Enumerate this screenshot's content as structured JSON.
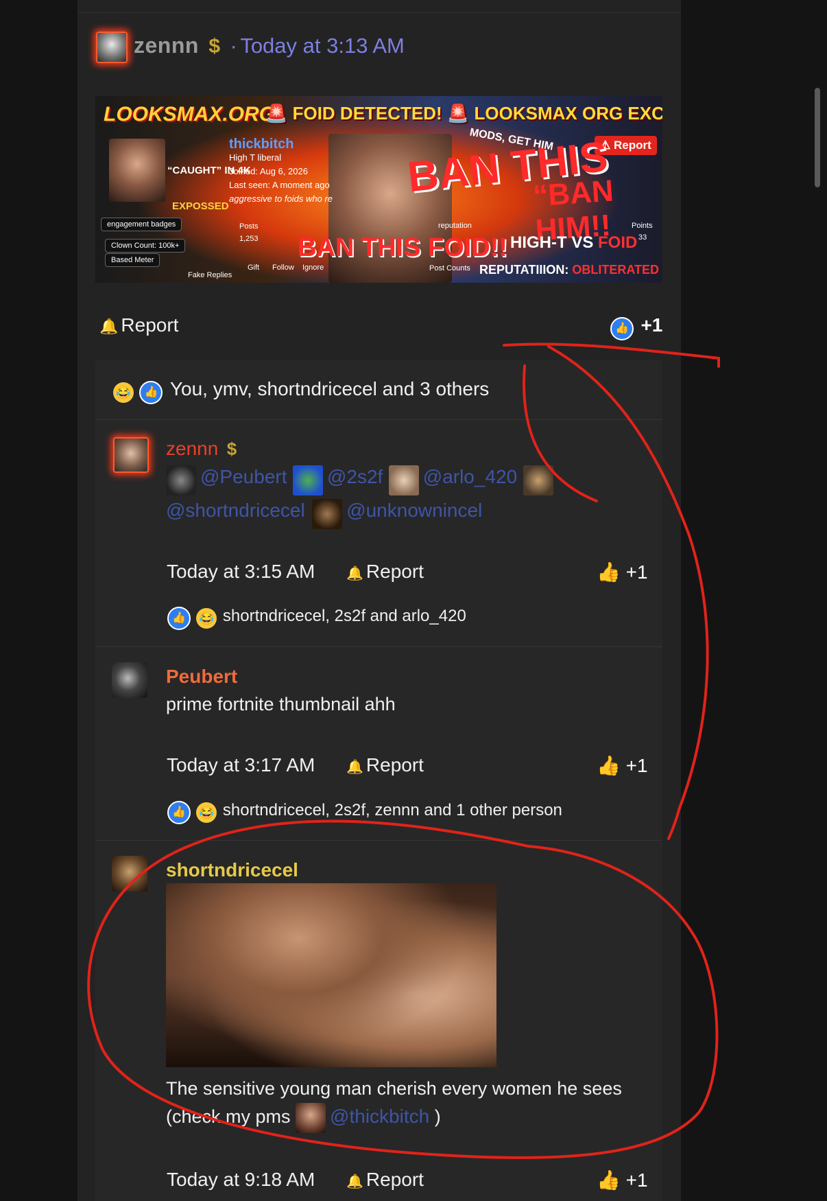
{
  "post": {
    "author": "zennn",
    "dollar": "$",
    "separator": "·",
    "timestamp": "Today at 3:13 AM",
    "report_label": "Report",
    "like_count": "+1",
    "reactions_summary": "You, ymv, shortndricecel and 3 others"
  },
  "banner": {
    "logo": "LOOKSMAX.ORG",
    "headline": "🚨 FOID DETECTED! 🚨 LOOKSMAX ORG EXCLUSIVE",
    "username": "thickbitch",
    "tagline": "High T liberal",
    "joined": "Joined: Aug 6, 2026",
    "last_seen": "Last seen: A moment ago",
    "bio": "aggressive to foids who re",
    "caught": "“CAUGHT” IN 4K",
    "exposed": "EXPOSSED",
    "chip1": "engagement badges",
    "chip2": "Clown Count: 100k+",
    "chip3": "Based Meter",
    "posts_label": "Posts",
    "posts_value": "1,253",
    "ban_this": "BAN THIS",
    "ban_him": "“BAN HIM!!",
    "ban_foid": "BAN THIS FOID!!",
    "mods": "MODS, GET HIM",
    "report": "⚠ Report",
    "vs_prefix": "HIGH-T VS ",
    "vs_foid": "FOID",
    "rep_prefix": "REPUTATIIION: ",
    "rep_value": "OBLITERATED",
    "gift": "Gift",
    "follow": "Follow",
    "ignore": "Ignore",
    "fake_replies": "Fake Replies",
    "post_counts": "Post Counts",
    "points_label": "Points",
    "points_value": "33",
    "reputation": "reputation"
  },
  "comments": [
    {
      "author": "zennn",
      "dollar": "$",
      "author_color": "#e8412a",
      "mentions": [
        "@Peubert",
        "@2s2f",
        "@arlo_420",
        "@shortndricecel",
        "@unknownincel"
      ],
      "time": "Today at 3:15 AM",
      "report": "Report",
      "like": "+1",
      "reactions": "shortndricecel, 2s2f and arlo_420"
    },
    {
      "author": "Peubert",
      "author_color": "#f06b3c",
      "text": "prime fortnite thumbnail ahh",
      "time": "Today at 3:17 AM",
      "report": "Report",
      "like": "+1",
      "reactions": "shortndricecel, 2s2f, zennn and 1 other person"
    },
    {
      "author": "shortndricecel",
      "author_color": "#e6c94a",
      "text_part1": "The sensitive young man cherish every women he sees",
      "text_part2": "(check my pms",
      "mention": "@thickbitch",
      "text_part3": ")",
      "time": "Today at 9:18 AM",
      "report": "Report",
      "like": "+1"
    }
  ],
  "icons": {
    "bell": "🔔",
    "thumb": "👍",
    "laugh": "😂"
  },
  "colors": {
    "timestamp": "#7d7fe0",
    "mention": "#3e55a8",
    "annotation": "#e0231a",
    "like_blue": "#2f7ef0"
  }
}
